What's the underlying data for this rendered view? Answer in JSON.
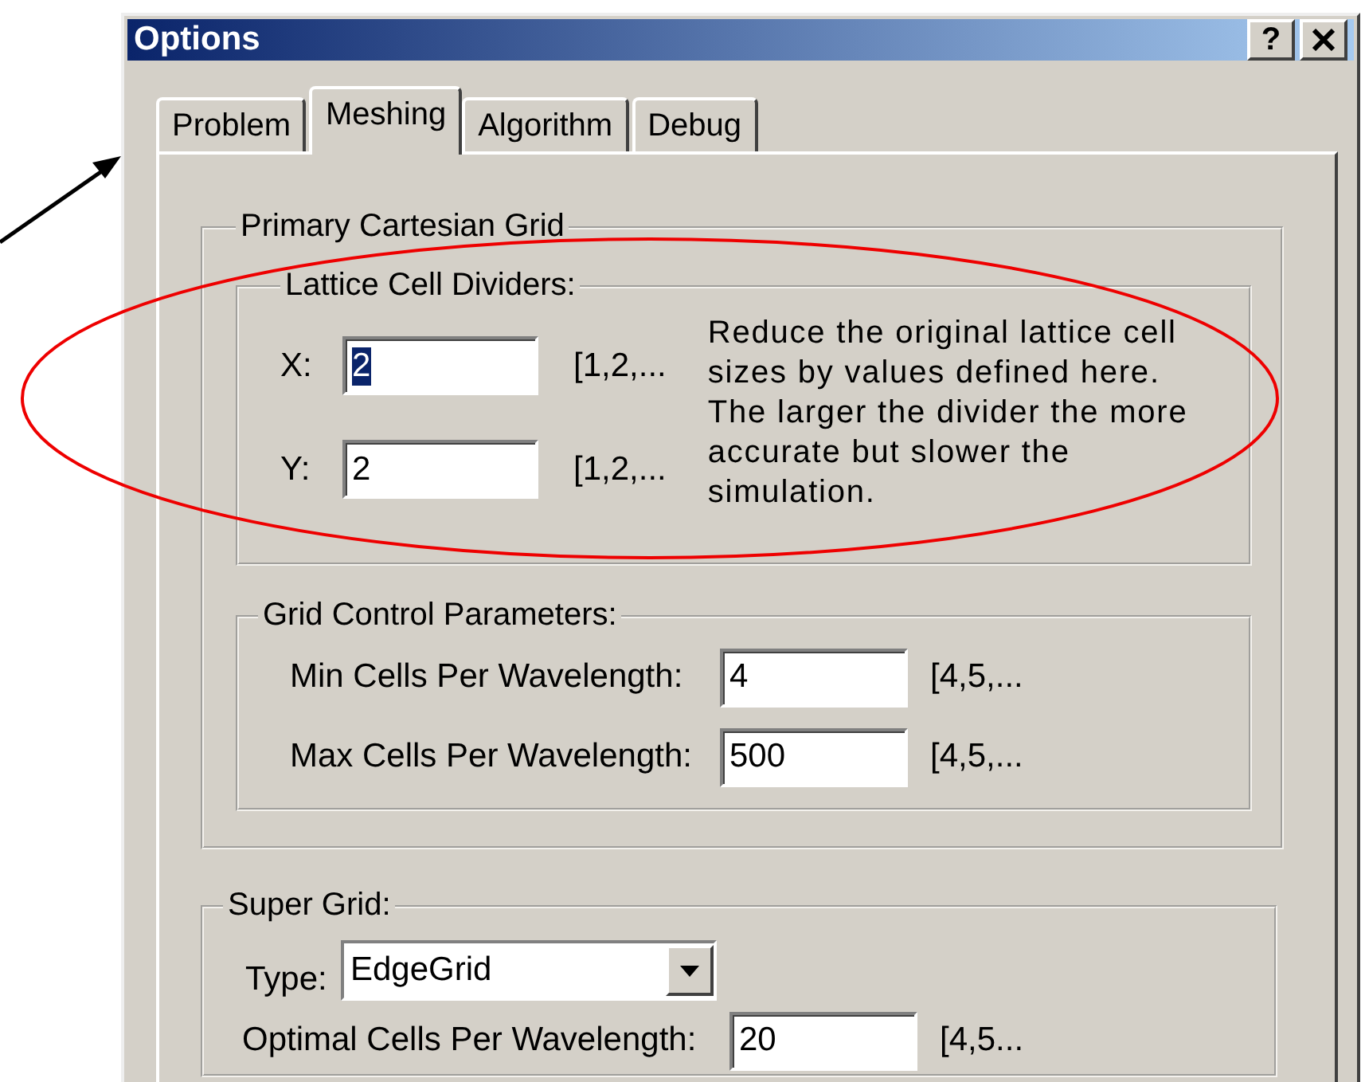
{
  "window": {
    "title": "Options",
    "help_button": "?"
  },
  "tabs": [
    {
      "label": "Problem",
      "selected": false
    },
    {
      "label": "Meshing",
      "selected": true
    },
    {
      "label": "Algorithm",
      "selected": false
    },
    {
      "label": "Debug",
      "selected": false
    }
  ],
  "primary_cartesian_grid": {
    "title": "Primary Cartesian Grid",
    "lattice_cell_dividers": {
      "title": "Lattice Cell Dividers:",
      "fields": [
        {
          "label": "X:",
          "value": "2",
          "range": "[1,2,...",
          "text_selected": true
        },
        {
          "label": "Y:",
          "value": "2",
          "range": "[1,2,...",
          "text_selected": false
        }
      ],
      "description": "Reduce the original lattice cell sizes by values defined here. The larger the divider the more accurate but slower the simulation."
    },
    "grid_control_parameters": {
      "title": "Grid Control Parameters:",
      "fields": [
        {
          "label": "Min Cells Per Wavelength:",
          "value": "4",
          "range": "[4,5,...",
          "text_selected": false
        },
        {
          "label": "Max Cells Per Wavelength:",
          "value": "500",
          "range": "[4,5,...",
          "text_selected": false
        }
      ]
    }
  },
  "super_grid": {
    "title": "Super Grid:",
    "type": {
      "label": "Type:",
      "value": "EdgeGrid"
    },
    "fields": [
      {
        "label": "Optimal Cells Per Wavelength:",
        "value": "20",
        "range": "[4,5...",
        "text_selected": false
      }
    ]
  }
}
